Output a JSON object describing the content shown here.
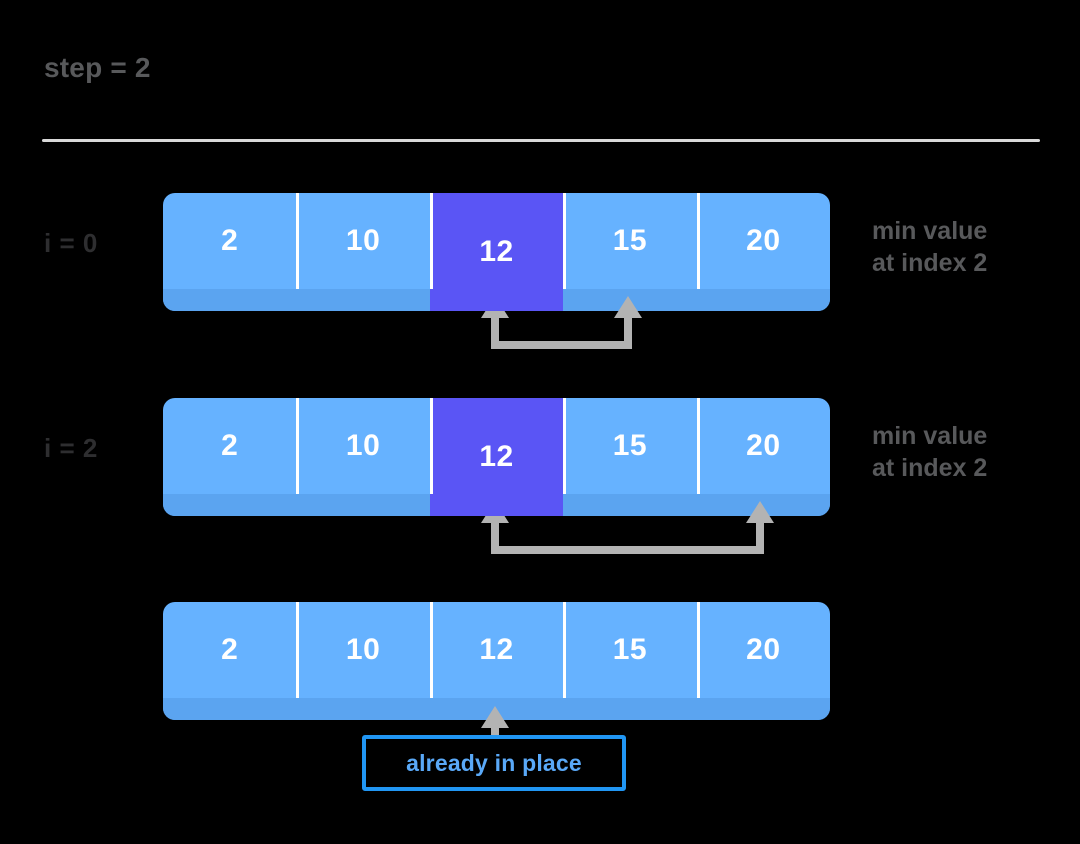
{
  "header": {
    "step_label": "step = 2",
    "divider": "horizontal-rule"
  },
  "colors": {
    "background": "#000000",
    "cell": "#66b2ff",
    "cell_base_shadow": "#5ba4f0",
    "cell_highlight": "#5a55f5",
    "cell_text": "#ffffff",
    "divider": "#d9d9d9",
    "label_text": "#2e2e30",
    "note_text": "#58595b",
    "connector": "#b3b3b3",
    "box_border": "#2196f3",
    "box_text": "#5aa9f8"
  },
  "rows": [
    {
      "index_label": "i = 0",
      "values": [
        "2",
        "10",
        "12",
        "15",
        "20"
      ],
      "highlight_index": 2,
      "note": "min value\nat index 2",
      "connector": {
        "from_index": 2,
        "to_index": 3
      }
    },
    {
      "index_label": "i = 2",
      "values": [
        "2",
        "10",
        "12",
        "15",
        "20"
      ],
      "highlight_index": 2,
      "note": "min value\nat index 2",
      "connector": {
        "from_index": 2,
        "to_index": 4
      }
    },
    {
      "index_label": "",
      "values": [
        "2",
        "10",
        "12",
        "15",
        "20"
      ],
      "highlight_index": -1,
      "note": "",
      "connector": {
        "from_index": 2,
        "to_index": -1
      }
    }
  ],
  "callout": {
    "label": "already in place",
    "points_to_index": 2
  }
}
